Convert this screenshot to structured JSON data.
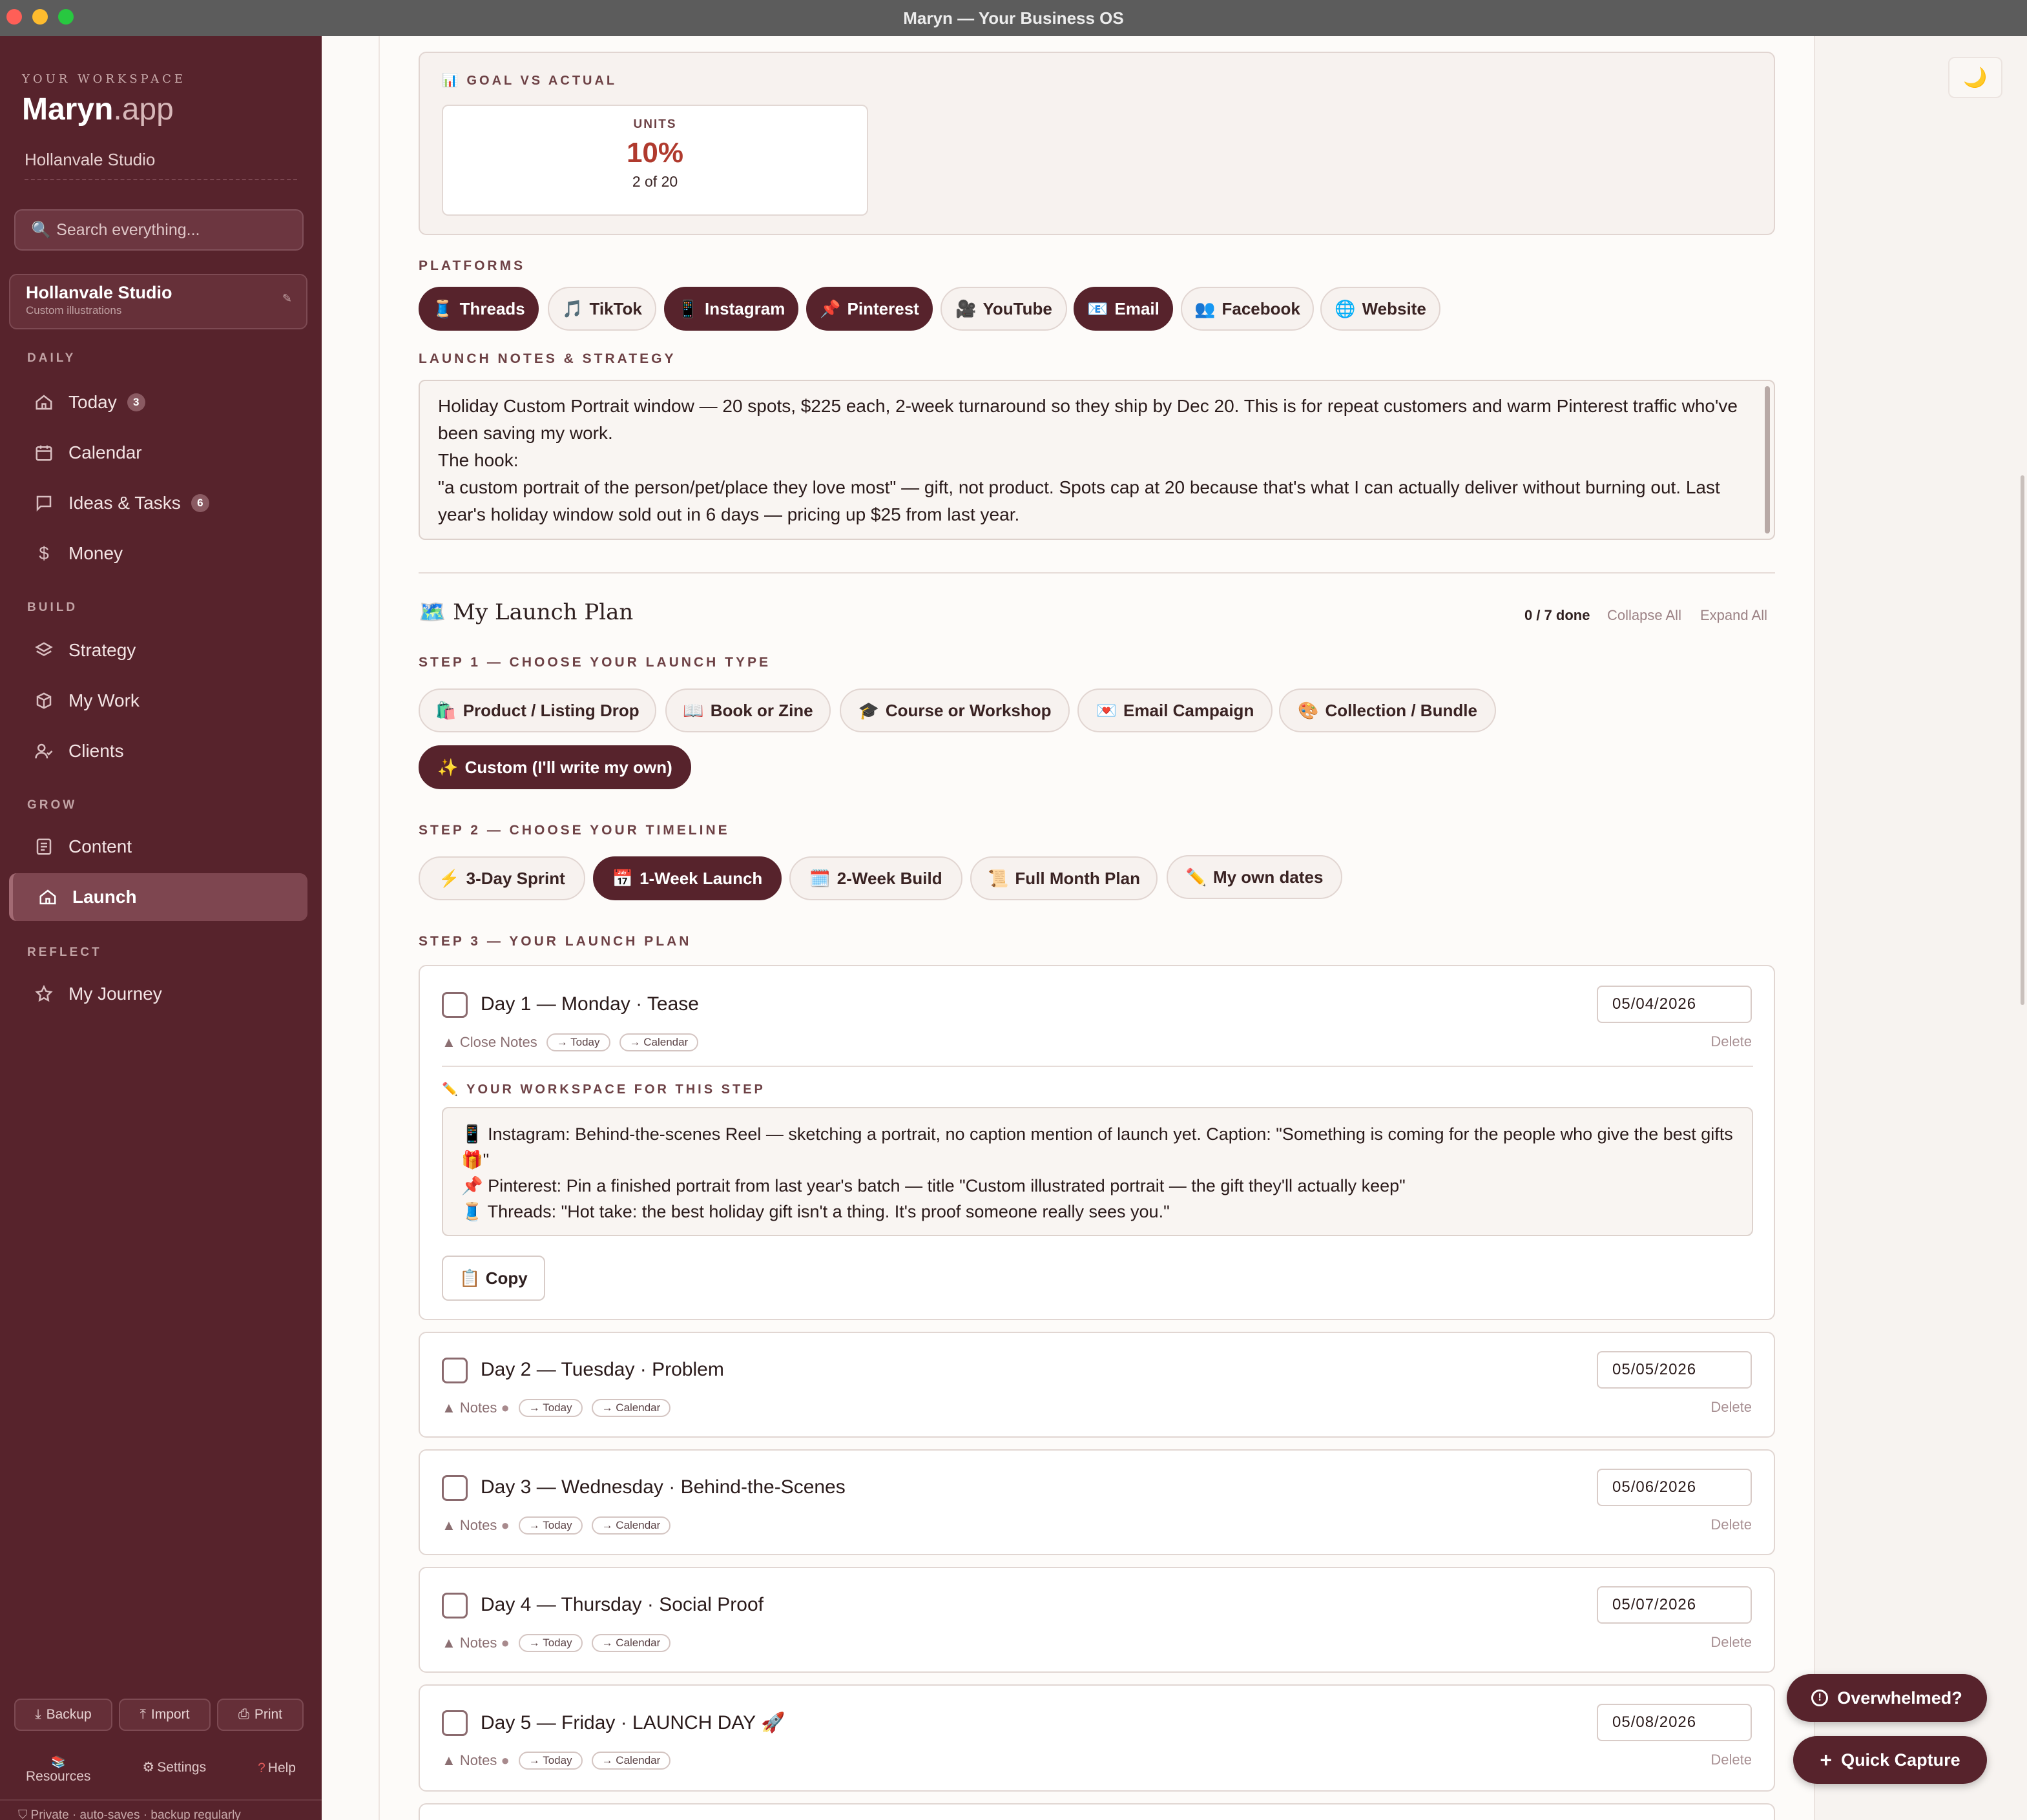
{
  "window": {
    "title": "Maryn — Your Business OS"
  },
  "sidebar": {
    "workspace_label": "YOUR WORKSPACE",
    "brand_main": "Maryn",
    "brand_suffix": ".app",
    "studio_name": "Hollanvale Studio",
    "search_placeholder": "Search everything...",
    "studio_card": {
      "name": "Hollanvale Studio",
      "subtitle": "Custom illustrations"
    },
    "sections": {
      "daily": "DAILY",
      "build": "BUILD",
      "grow": "GROW",
      "reflect": "REFLECT"
    },
    "items": [
      {
        "label": "Today",
        "badge": "3"
      },
      {
        "label": "Calendar"
      },
      {
        "label": "Ideas & Tasks",
        "badge": "6"
      },
      {
        "label": "Money"
      },
      {
        "label": "Strategy"
      },
      {
        "label": "My Work"
      },
      {
        "label": "Clients"
      },
      {
        "label": "Content"
      },
      {
        "label": "Launch"
      },
      {
        "label": "My Journey"
      }
    ],
    "buttons": {
      "backup": "Backup",
      "import": "Import",
      "print": "Print"
    },
    "utils": {
      "resources": "Resources",
      "settings": "Settings",
      "help": "Help"
    },
    "footer": "Private · auto-saves · backup regularly"
  },
  "goal": {
    "heading": "GOAL VS ACTUAL",
    "units_label": "UNITS",
    "percent": "10%",
    "detail": "2 of 20"
  },
  "platforms": {
    "heading": "PLATFORMS",
    "items": [
      {
        "icon": "🧵",
        "label": "Threads",
        "selected": true
      },
      {
        "icon": "🎵",
        "label": "TikTok",
        "selected": false
      },
      {
        "icon": "📱",
        "label": "Instagram",
        "selected": true
      },
      {
        "icon": "📌",
        "label": "Pinterest",
        "selected": true
      },
      {
        "icon": "🎥",
        "label": "YouTube",
        "selected": false
      },
      {
        "icon": "📧",
        "label": "Email",
        "selected": true
      },
      {
        "icon": "👥",
        "label": "Facebook",
        "selected": false
      },
      {
        "icon": "🌐",
        "label": "Website",
        "selected": false
      }
    ]
  },
  "notes": {
    "heading": "LAUNCH NOTES & STRATEGY",
    "line1": "Holiday Custom Portrait window — 20 spots, $225 each, 2-week turnaround so they ship by Dec 20. This is for repeat customers and warm Pinterest traffic who've been saving my work.",
    "line2": "The hook:",
    "line3": "\"a custom portrait of the person/pet/place they love most\" — gift, not product. Spots cap at 20 because that's what I can actually deliver without burning out. Last year's holiday window sold out in 6 days — pricing up $25 from last year."
  },
  "plan": {
    "title": "My Launch Plan",
    "progress": "0 / 7 done",
    "collapse": "Collapse All",
    "expand": "Expand All",
    "step1": "STEP 1 — CHOOSE YOUR LAUNCH TYPE",
    "types": [
      {
        "icon": "🛍️",
        "label": "Product / Listing Drop"
      },
      {
        "icon": "📖",
        "label": "Book or Zine"
      },
      {
        "icon": "🎓",
        "label": "Course or Workshop"
      },
      {
        "icon": "💌",
        "label": "Email Campaign"
      },
      {
        "icon": "🎨",
        "label": "Collection / Bundle"
      },
      {
        "icon": "✨",
        "label": "Custom (I'll write my own)",
        "selected": true
      }
    ],
    "step2": "STEP 2 — CHOOSE YOUR TIMELINE",
    "timelines": [
      {
        "icon": "⚡",
        "label": "3-Day Sprint"
      },
      {
        "icon": "📅",
        "label": "1-Week Launch",
        "selected": true
      },
      {
        "icon": "🗓️",
        "label": "2-Week Build"
      },
      {
        "icon": "📜",
        "label": "Full Month Plan"
      },
      {
        "icon": "✏️",
        "label": "My own dates"
      }
    ],
    "step3": "STEP 3 — YOUR LAUNCH PLAN",
    "days": [
      {
        "title": "Day 1 — Monday · Tease",
        "date": "05/04/2026",
        "notes_label": "Close Notes"
      },
      {
        "title": "Day 2 — Tuesday · Problem",
        "date": "05/05/2026",
        "notes_label": "Notes"
      },
      {
        "title": "Day 3 — Wednesday · Behind-the-Scenes",
        "date": "05/06/2026",
        "notes_label": "Notes"
      },
      {
        "title": "Day 4 — Thursday · Social Proof",
        "date": "05/07/2026",
        "notes_label": "Notes"
      },
      {
        "title": "Day 5 — Friday · LAUNCH DAY 🚀",
        "date": "05/08/2026",
        "notes_label": "Notes"
      }
    ],
    "tag_today": "→ Today",
    "tag_calendar": "→ Calendar",
    "delete": "Delete",
    "workspace_heading": "YOUR WORKSPACE FOR THIS STEP",
    "workspace_lines": [
      "📱 Instagram: Behind-the-scenes Reel — sketching a portrait, no caption mention of launch yet. Caption: \"Something is coming for the people who give the best gifts 🎁\"",
      "📌 Pinterest: Pin a finished portrait from last year's batch — title \"Custom illustrated portrait — the gift they'll actually keep\"",
      "🧵 Threads: \"Hot take: the best holiday gift isn't a thing. It's proof someone really sees you.\""
    ],
    "copy": "Copy"
  },
  "fab": {
    "overwhelmed": "Overwhelmed?",
    "capture": "Quick Capture"
  },
  "theme_icon": "🌙",
  "colors": {
    "sidebar": "#57232c",
    "accent": "#57232c",
    "percent": "#b03a2e"
  }
}
